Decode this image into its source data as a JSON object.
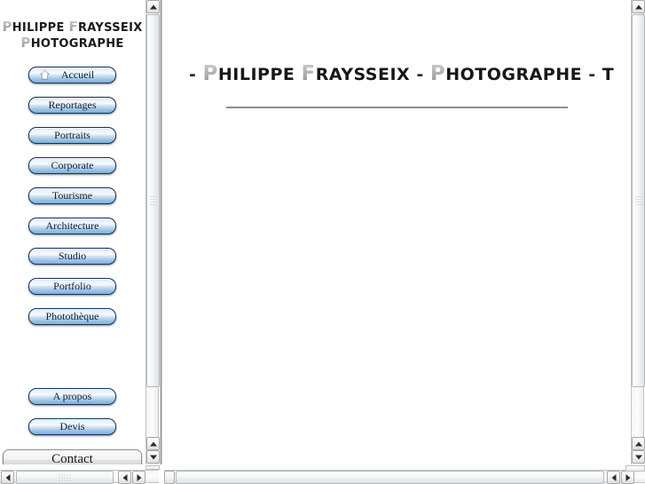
{
  "site": {
    "title_line1_cap": "P",
    "title_line1_rest": "HILIPPE ",
    "title_line1_cap2": "F",
    "title_line1_rest2": "RAYSSEIX",
    "title_line2_cap": "P",
    "title_line2_rest": "HOTOGRAPHE"
  },
  "sidebar": {
    "items": [
      {
        "label": "Accueil",
        "icon": "home-icon"
      },
      {
        "label": "Reportages",
        "icon": ""
      },
      {
        "label": "Portraits",
        "icon": ""
      },
      {
        "label": "Corporate",
        "icon": ""
      },
      {
        "label": "Tourisme",
        "icon": ""
      },
      {
        "label": "Architecture",
        "icon": ""
      },
      {
        "label": "Studio",
        "icon": ""
      },
      {
        "label": "Portfolio",
        "icon": ""
      },
      {
        "label": "Photothèque",
        "icon": ""
      }
    ],
    "secondary_items": [
      {
        "label": "A propos"
      },
      {
        "label": "Devis"
      }
    ],
    "contact_label": "Contact"
  },
  "main": {
    "heading": {
      "lead_dash": "-",
      "cap1": "P",
      "word1": "HILIPPE",
      "cap2": "F",
      "word2": "RAYSSEIX",
      "mid_dash": "-",
      "cap3": "P",
      "word3": "HOTOGRAPHE",
      "trail_dash": "-",
      "truncated": "T"
    }
  },
  "scrollbars": {
    "left_vertical": {
      "up_arrow": "scroll-up",
      "down_arrow": "scroll-down"
    },
    "left_horizontal": {
      "left_arrow": "scroll-left",
      "right_arrow": "scroll-right"
    },
    "right_vertical": {
      "up_arrow": "scroll-up",
      "down_arrow": "scroll-down"
    },
    "right_horizontal": {
      "left_arrow": "scroll-left",
      "right_arrow": "scroll-right"
    }
  },
  "colors": {
    "button_border": "#17315c",
    "button_fill_top": "#eaf3fb",
    "button_fill_bottom": "#7fb0d8",
    "contact_fill": "#e2e2e2",
    "rule": "#8e8e8e",
    "heading_text": "#171717",
    "cap_gradient_top": "#cfcfcf",
    "cap_gradient_bottom": "#8f8f8f"
  }
}
